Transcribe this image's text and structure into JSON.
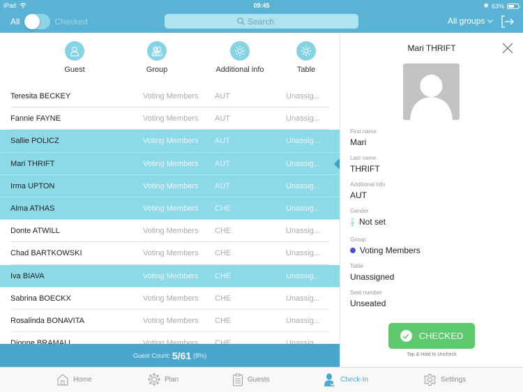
{
  "status_bar": {
    "device": "iPad",
    "time": "09:45",
    "battery": "63%",
    "battery_level": 0.63
  },
  "header": {
    "filter_all_label": "All",
    "filter_checked_label": "Checked",
    "search_placeholder": "Search",
    "groups_label": "All groups"
  },
  "columns": [
    {
      "label": "Guest",
      "icon": "person-icon"
    },
    {
      "label": "Group",
      "icon": "group-icon"
    },
    {
      "label": "Additional info",
      "icon": "sun-icon"
    },
    {
      "label": "Table",
      "icon": "sun-icon"
    }
  ],
  "guests": [
    {
      "name": "Teresita BECKEY",
      "group": "Voting Members",
      "info": "AUT",
      "table": "Unassig...",
      "checked": false
    },
    {
      "name": "Fannie FAYNE",
      "group": "Voting Members",
      "info": "AUT",
      "table": "Unassig...",
      "checked": false
    },
    {
      "name": "Sallie POLICZ",
      "group": "Voting Members",
      "info": "AUT",
      "table": "Unassig...",
      "checked": true
    },
    {
      "name": "Mari THRIFT",
      "group": "Voting Members",
      "info": "AUT",
      "table": "Unassig...",
      "checked": true,
      "selected": true
    },
    {
      "name": "Irma UPTON",
      "group": "Voting Members",
      "info": "AUT",
      "table": "Unassig...",
      "checked": true
    },
    {
      "name": "Alma ATHAS",
      "group": "Voting Members",
      "info": "CHE",
      "table": "Unassig...",
      "checked": true
    },
    {
      "name": "Donte ATWILL",
      "group": "Voting Members",
      "info": "CHE",
      "table": "Unassig...",
      "checked": false
    },
    {
      "name": "Chad BARTKOWSKI",
      "group": "Voting Members",
      "info": "CHE",
      "table": "Unassig...",
      "checked": false
    },
    {
      "name": "Iva BIAVA",
      "group": "Voting Members",
      "info": "CHE",
      "table": "Unassig...",
      "checked": true
    },
    {
      "name": "Sabrina BOECKX",
      "group": "Voting Members",
      "info": "CHE",
      "table": "Unassig...",
      "checked": false
    },
    {
      "name": "Rosalinda BONAVITA",
      "group": "Voting Members",
      "info": "CHE",
      "table": "Unassig...",
      "checked": false
    },
    {
      "name": "Dionne BRAMALL",
      "group": "Voting Members",
      "info": "CHE",
      "table": "Unassig...",
      "checked": false
    }
  ],
  "guest_count": {
    "label": "Guest Count:",
    "value": "5/61",
    "percent": "(8%)"
  },
  "detail": {
    "title": "Mari THRIFT",
    "fields": {
      "first_name": {
        "label": "First name",
        "value": "Mari"
      },
      "last_name": {
        "label": "Last name",
        "value": "THRIFT"
      },
      "additional_info": {
        "label": "Additional info",
        "value": "AUT"
      },
      "gender": {
        "label": "Gender",
        "value": "Not set"
      },
      "group": {
        "label": "Group",
        "value": "Voting Members",
        "color": "#4a4fd6"
      },
      "table": {
        "label": "Table",
        "value": "Unassigned"
      },
      "seat": {
        "label": "Seat number",
        "value": "Unseated"
      }
    },
    "checked_button": "CHECKED",
    "hint": "Tap & Hold to Uncheck"
  },
  "tabs": [
    {
      "label": "Home",
      "icon": "home-icon",
      "active": false
    },
    {
      "label": "Plan",
      "icon": "plan-icon",
      "active": false
    },
    {
      "label": "Guests",
      "icon": "clipboard-icon",
      "active": false
    },
    {
      "label": "Check-In",
      "icon": "check-in-person-icon",
      "active": true
    },
    {
      "label": "Settings",
      "icon": "gear-icon",
      "active": false
    }
  ],
  "colors": {
    "header_bg": "#5ab3d4",
    "selected_row": "#8cd9e8",
    "count_bar": "#4aa6cc",
    "checked_green": "#5bc96c",
    "active_tab": "#4ba8d0"
  }
}
